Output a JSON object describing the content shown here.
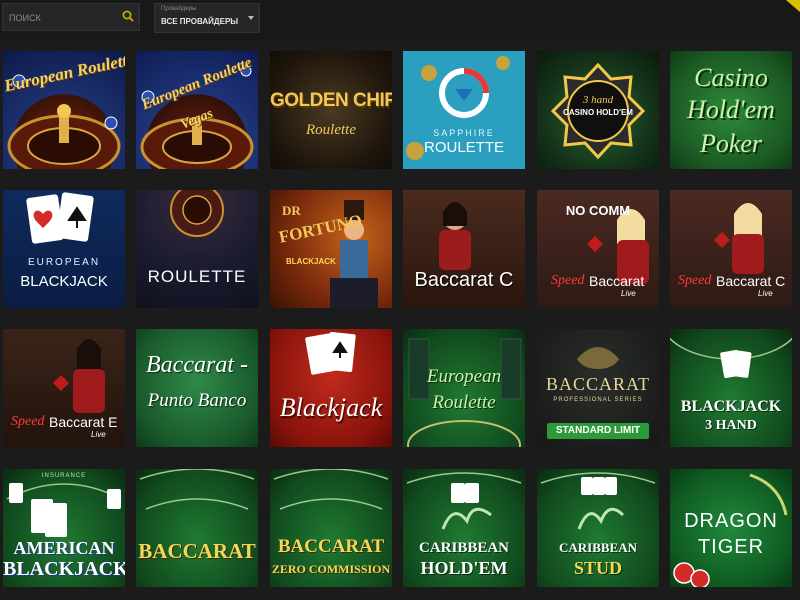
{
  "search": {
    "placeholder": "ПОИСК",
    "icon": "search-icon"
  },
  "provider_filter": {
    "label": "Провайдеры",
    "value": "ВСЕ ПРОВАЙДЕРЫ"
  },
  "games": [
    {
      "title": "European Roulette"
    },
    {
      "title_1": "European Roulette",
      "title_2": "Vegas"
    },
    {
      "title_1": "GOLDEN CHIP",
      "title_2": "Roulette"
    },
    {
      "title_1": "SAPPHIRE",
      "title_2": "ROULETTE"
    },
    {
      "badge": "3 hand",
      "title": "CASINO HOLD'EM"
    },
    {
      "title_1": "Casino",
      "title_2": "Hold'em",
      "title_3": "Poker"
    },
    {
      "title_1": "EUROPEAN",
      "title_2": "BLACKJACK"
    },
    {
      "title": "ROULETTE"
    },
    {
      "title_1": "DR",
      "title_2": "FORTUNO",
      "title_3": "BLACKJACK"
    },
    {
      "title": "Baccarat C"
    },
    {
      "tag": "NO COMM",
      "speed": "Speed",
      "title": "Baccarat",
      "live": "Live"
    },
    {
      "speed": "Speed",
      "title": "Baccarat C",
      "live": "Live"
    },
    {
      "speed": "Speed",
      "title": "Baccarat E",
      "live": "Live"
    },
    {
      "title_1": "Baccarat -",
      "title_2": "Punto Banco"
    },
    {
      "title": "Blackjack"
    },
    {
      "title_1": "European",
      "title_2": "Roulette"
    },
    {
      "title": "BACCARAT",
      "subtitle": "PROFESSIONAL SERIES",
      "banner": "STANDARD LIMIT"
    },
    {
      "title_1": "BLACKJACK",
      "title_2": "3 HAND"
    },
    {
      "header": "INSURANCE",
      "title_1": "AMERICAN",
      "title_2": "BLACKJACK"
    },
    {
      "title": "BACCARAT"
    },
    {
      "title_1": "BACCARAT",
      "title_2": "ZERO COMMISSION"
    },
    {
      "title_1": "CARIBBEAN",
      "title_2": "HOLD'EM"
    },
    {
      "title_1": "CARIBBEAN",
      "title_2": "STUD"
    },
    {
      "title_1": "DRAGON",
      "title_2": "TIGER"
    }
  ]
}
